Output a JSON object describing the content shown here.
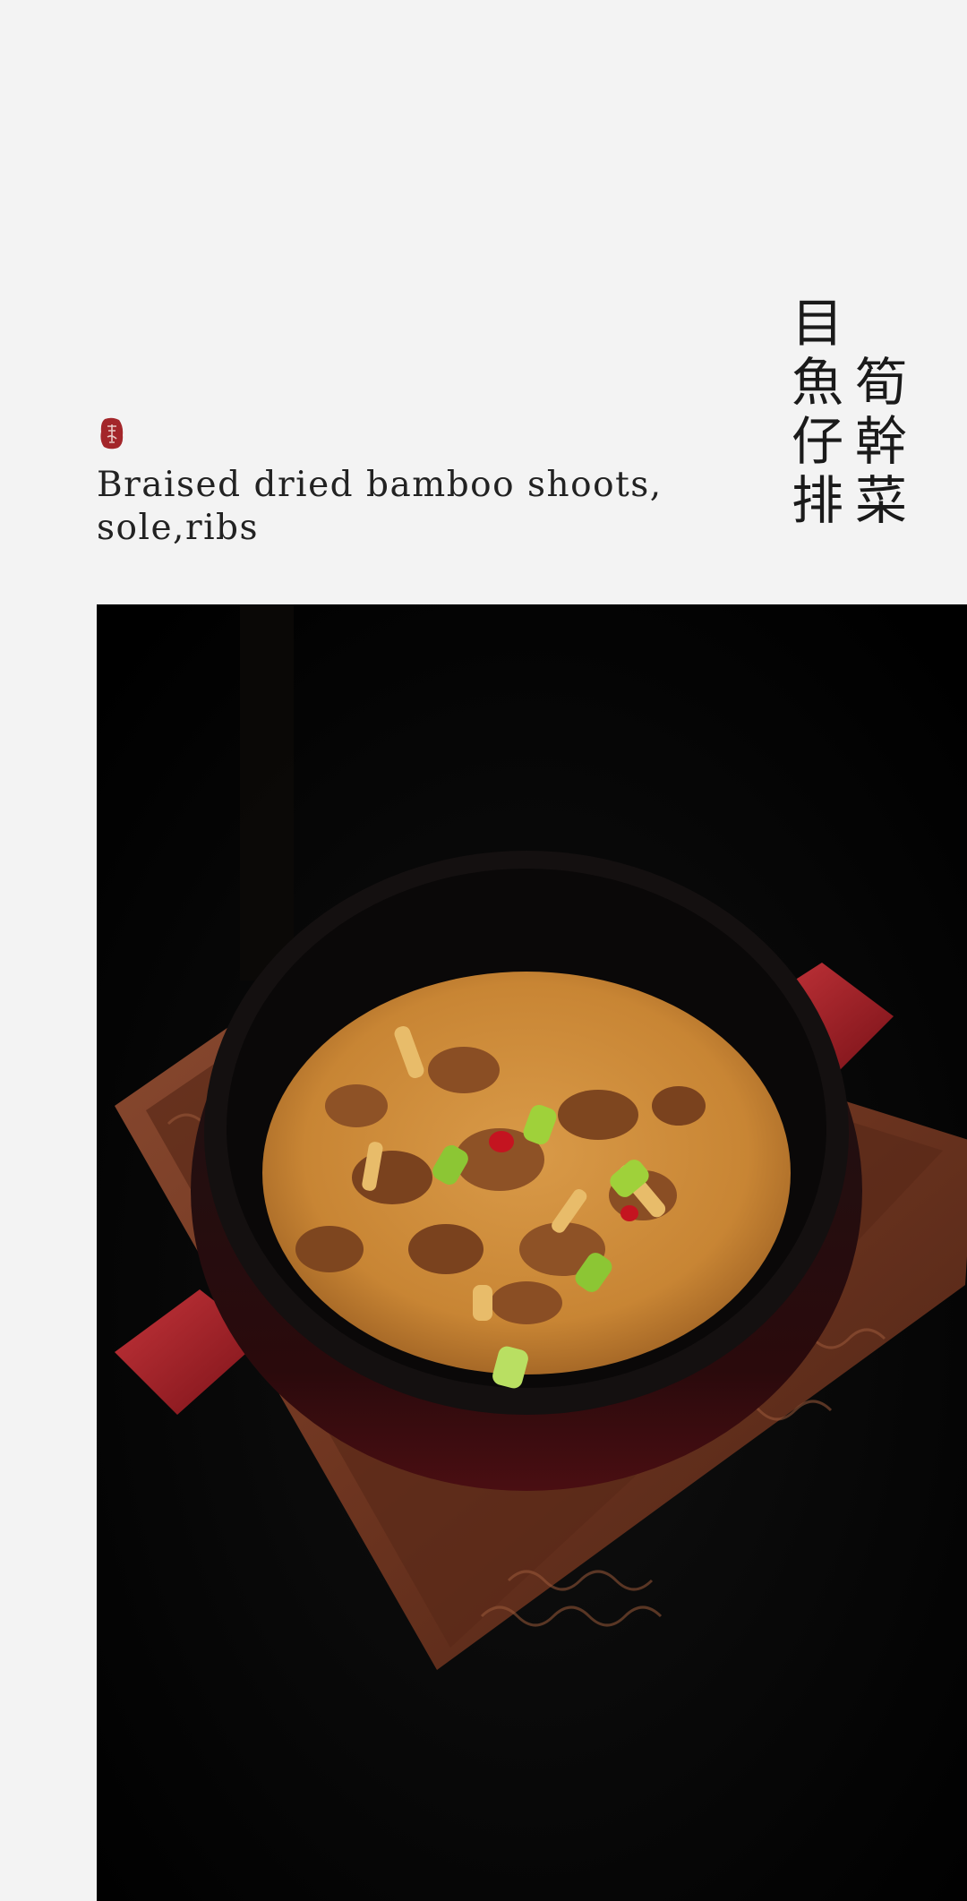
{
  "dish": {
    "name_en_line1": "Braised dried bamboo shoots,",
    "name_en_line2": "sole,ribs",
    "name_cn_col1": "目魚仔排",
    "name_cn_col2": "筍幹菜"
  },
  "seal": {
    "icon": "seal-stamp-icon",
    "color": "#a3262a"
  },
  "photo": {
    "subject": "clay-pot-dish-photo"
  }
}
